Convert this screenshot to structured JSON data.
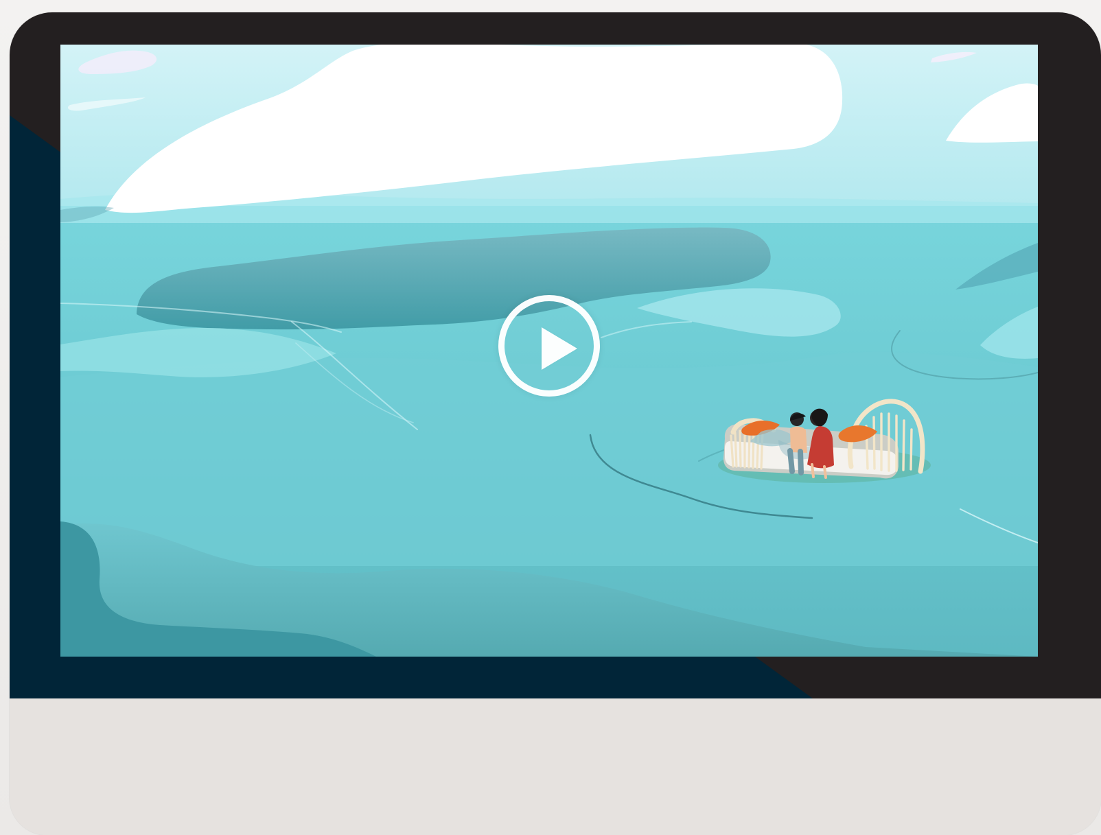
{
  "video_player": {
    "play_action": "play",
    "state": "paused"
  },
  "scene": {
    "characters": [
      "boy",
      "girl"
    ],
    "object": "floating bed"
  },
  "icons": [
    "play-icon"
  ],
  "colors": {
    "bezel": "#231f20",
    "accent": "#012538",
    "chin": "#e6e2df",
    "water": "#78d3da",
    "water_deep": "#4ba5b0",
    "cloud": "#ffffff",
    "dress": "#c83c36",
    "pillow": "#e57533"
  }
}
